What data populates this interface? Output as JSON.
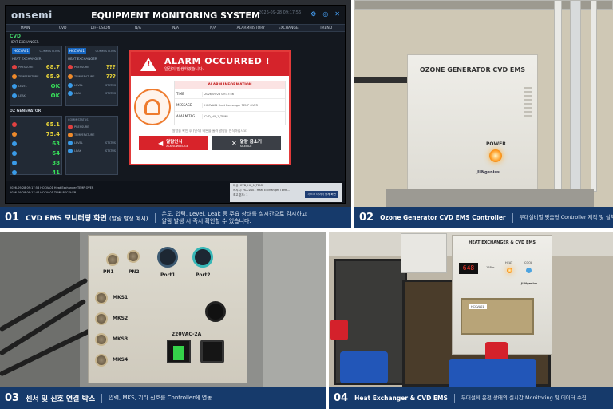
{
  "panels": {
    "p1": {
      "num": "01",
      "title": "CVD EMS 모니터링 화면",
      "title_note": "(알람 발생 예시)",
      "desc_line1": "온도, 압력, Level, Leak 등 주요 상태를 실시간으로 감시하고",
      "desc_line2": "알람 발생 시 즉시 확인할 수 있습니다."
    },
    "p2": {
      "num": "02",
      "title": "Ozone Generator CVD EMS Controller",
      "desc": "부대설비별 맞춤형 Controller 제작 및 설치"
    },
    "p3": {
      "num": "03",
      "title": "센서 및 신호 연결 박스",
      "desc": "압력, MKS, 기타 신호를 Controller에 연동"
    },
    "p4": {
      "num": "04",
      "title": "Heat Exchanger & CVD EMS",
      "desc": "부대설비 운전 상태의 실시간 Monitoring 및 데이터 수집"
    }
  },
  "monitor": {
    "logo": "onsemi",
    "system_title": "EQUIPMENT MONITORING SYSTEM",
    "clock": "2026-09-28 09:17:56",
    "nav": [
      "MAIN",
      "CVD",
      "DIFFUSION",
      "N/A",
      "N/A",
      "N/A",
      "ALARMHISTORY",
      "EXCHANGE",
      "TREND"
    ],
    "section_cvd": "CVD",
    "sub_heat": "HEAT EXCHANGER",
    "section_oz": "OZ GENERATOR",
    "card_tag1": "HCCVA01",
    "card_tag2": "HCCVA01",
    "comm_status": "COMM STATUS",
    "pressure_label": "PRESSURE",
    "temp_label": "TEMPERATURE",
    "level_label": "LEVEL",
    "leak_label": "LEAK",
    "status_label": "STATUS",
    "heat_label": "HEAT EXCHANGER",
    "val_pressure_1": "68.7",
    "val_temp_1": "65.9",
    "val_pressure_2": "???",
    "val_temp_2": "???",
    "ok": "OK",
    "oz_val_1": "65.1",
    "oz_val_2": "75.4",
    "oz_val_3": "63",
    "oz_val_4": "64",
    "oz_val_5": "38",
    "oz_val_6": "41",
    "log_line1": "2026-09-28 09:17:56   HCCVA01 Heat Exchanger TEMP OVER",
    "log_line2": "2026-09-28 09:17:44   HCCVA01 TEMP RECOVER",
    "log_right1": "대상:  CVD_HX_1_TEMP",
    "log_right2": "메시지:  HCCVA01 Heat Exchanger TEMP...",
    "log_right3": "최고 온도:  1",
    "log_button": "가스코 데이터 상세 화면"
  },
  "alarm": {
    "title": "ALARM OCCURRED !",
    "subtitle": "알람이 발생하였습니다.",
    "info_header": "ALARM INFORMATION",
    "time_label": "TIME",
    "time_value": "2026/09/28 09:17:56",
    "message_label": "MESSAGE",
    "message_value": "HCCVA01 Heat Exchanger TEMP OVER",
    "tag_label": "ALARM TAG",
    "tag_value": "CVD_HX_1_TEMP",
    "note": "알람을 확인 후 (인식) 버튼을 눌러 알람을 인식하십시오.",
    "ack_ko": "알람인식",
    "ack_en": "ACKNOWLEDGE",
    "silence_ko": "알람 음소거",
    "silence_en": "SILENCE"
  },
  "ozone_box": {
    "name": "OZONE GENERATOR CVD EMS",
    "power": "POWER",
    "brand": "JUNgenius"
  },
  "junction_box": {
    "pn1": "PN1",
    "pn2": "PN2",
    "mks1": "MKS1",
    "mks2": "MKS2",
    "mks3": "MKS3",
    "mks4": "MKS4",
    "port1": "Port1",
    "port2": "Port2",
    "power_spec": "220VAC-2A"
  },
  "heat_box": {
    "name": "HEAT EXCHANGER & CVD EMS",
    "display": "648",
    "indicator1": "12Bar",
    "indicator2": "HEAT",
    "indicator3": "COOL",
    "brand": "JUNgenius",
    "plate": "HCCVA01"
  }
}
